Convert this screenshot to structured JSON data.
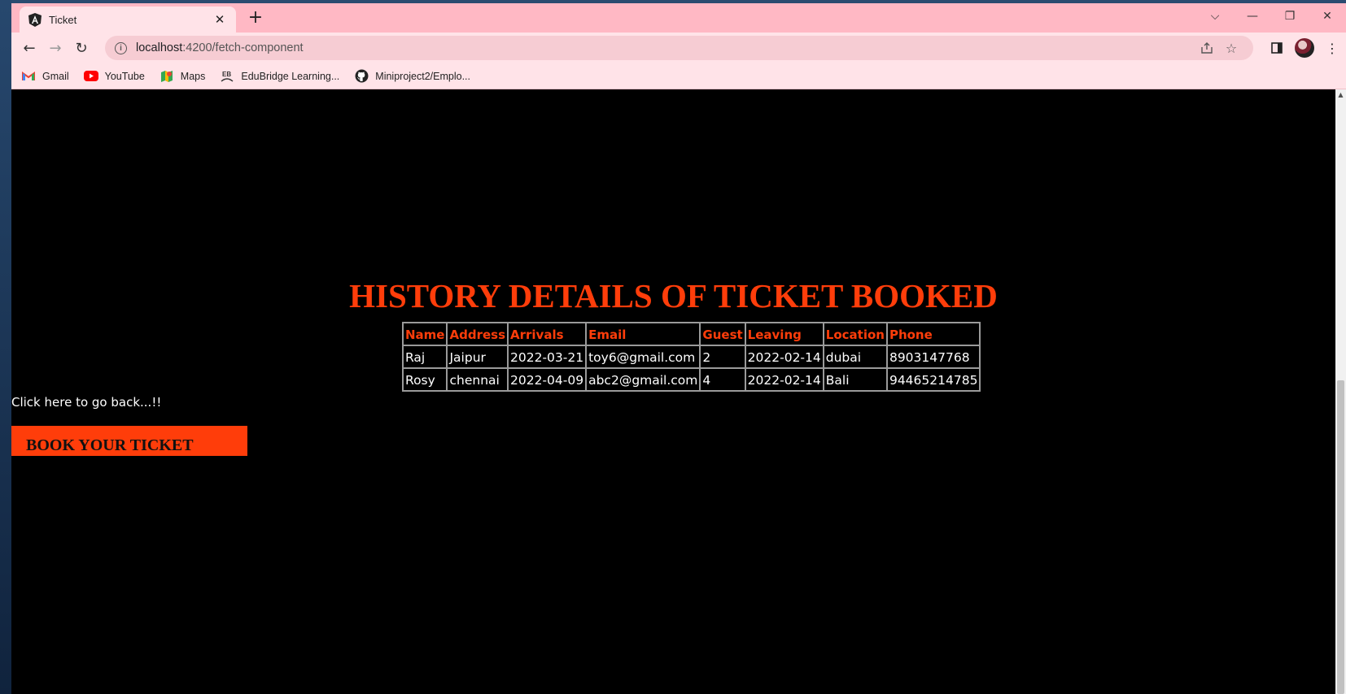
{
  "browser": {
    "tab": {
      "title": "Ticket",
      "close_glyph": "✕"
    },
    "new_tab_glyph": "+",
    "window_controls": {
      "dropdown": "⌵",
      "minimize": "—",
      "restore": "❐",
      "close": "✕"
    },
    "nav": {
      "back": "←",
      "forward": "→",
      "reload": "↻"
    },
    "url": {
      "host": "localhost",
      "path": ":4200/fetch-component"
    },
    "bookmarks": [
      {
        "label": "Gmail",
        "icon": "gmail-icon"
      },
      {
        "label": "YouTube",
        "icon": "youtube-icon"
      },
      {
        "label": "Maps",
        "icon": "maps-icon"
      },
      {
        "label": "EduBridge Learning...",
        "icon": "edubridge-icon"
      },
      {
        "label": "Miniproject2/Emplo...",
        "icon": "github-icon"
      }
    ]
  },
  "page": {
    "heading": "HISTORY DETAILS OF TICKET BOOKED",
    "table": {
      "headers": [
        "Name",
        "Address",
        "Arrivals",
        "Email",
        "Guest",
        "Leaving",
        "Location",
        "Phone"
      ],
      "rows": [
        [
          "Raj",
          "Jaipur",
          "2022-03-21",
          "toy6@gmail.com",
          "2",
          "2022-02-14",
          "dubai",
          "8903147768"
        ],
        [
          "Rosy",
          "chennai",
          "2022-04-09",
          "abc2@gmail.com",
          "4",
          "2022-02-14",
          "Bali",
          "94465214785"
        ]
      ]
    },
    "back_link": "Click here to go back...!!",
    "book_button": "BOOK YOUR TICKET"
  },
  "colors": {
    "accent": "#ff3d0a",
    "tabstrip": "#ffb8c4",
    "toolbar": "#ffe3e8",
    "page_bg": "#000000"
  }
}
